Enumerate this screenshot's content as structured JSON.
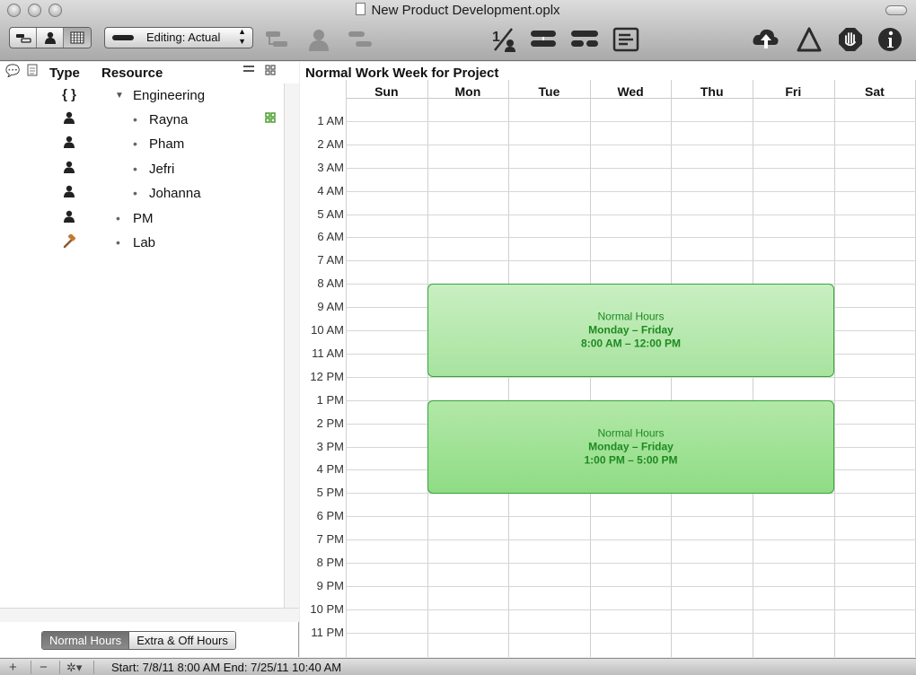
{
  "window": {
    "title": "New Product Development.oplx"
  },
  "toolbar": {
    "view_modes": [
      "task-view-icon",
      "resource-view-icon",
      "calendar-view-icon"
    ],
    "editing_popup_label": "Editing: Actual",
    "tools": [
      "add-task-icon",
      "add-resource-icon",
      "assign-icon",
      "complete-icon",
      "connect-icon",
      "split-icon",
      "report-icon",
      "publish-icon",
      "violations-icon",
      "stop-icon",
      "info-icon"
    ]
  },
  "left_pane": {
    "columns": {
      "type": "Type",
      "resource": "Resource"
    },
    "resources": [
      {
        "name": "Engineering",
        "type": "group",
        "level": 0,
        "expanded": true
      },
      {
        "name": "Rayna",
        "type": "staff",
        "level": 1,
        "leveled": true
      },
      {
        "name": "Pham",
        "type": "staff",
        "level": 1
      },
      {
        "name": "Jefri",
        "type": "staff",
        "level": 1
      },
      {
        "name": "Johanna",
        "type": "staff",
        "level": 1
      },
      {
        "name": "PM",
        "type": "staff",
        "level": 0
      },
      {
        "name": "Lab",
        "type": "equipment",
        "level": 0
      }
    ],
    "tabs": {
      "normal": "Normal Hours",
      "extra": "Extra & Off Hours",
      "selected": "normal"
    }
  },
  "calendar": {
    "title": "Normal Work Week for Project",
    "days": [
      "Sun",
      "Mon",
      "Tue",
      "Wed",
      "Thu",
      "Fri",
      "Sat"
    ],
    "hours": [
      "1 AM",
      "2 AM",
      "3 AM",
      "4 AM",
      "5 AM",
      "6 AM",
      "7 AM",
      "8 AM",
      "9 AM",
      "10 AM",
      "11 AM",
      "12 PM",
      "1 PM",
      "2 PM",
      "3 PM",
      "4 PM",
      "5 PM",
      "6 PM",
      "7 PM",
      "8 PM",
      "9 PM",
      "10 PM",
      "11 PM"
    ],
    "blocks": [
      {
        "title": "Normal Hours",
        "days": "Monday – Friday",
        "time": "8:00 AM – 12:00 PM"
      },
      {
        "title": "Normal Hours",
        "days": "Monday – Friday",
        "time": "1:00 PM – 5:00 PM"
      }
    ],
    "block_color": "#a8e39f"
  },
  "status": {
    "text": "Start: 7/8/11 8:00 AM End: 7/25/11 10:40 AM"
  }
}
